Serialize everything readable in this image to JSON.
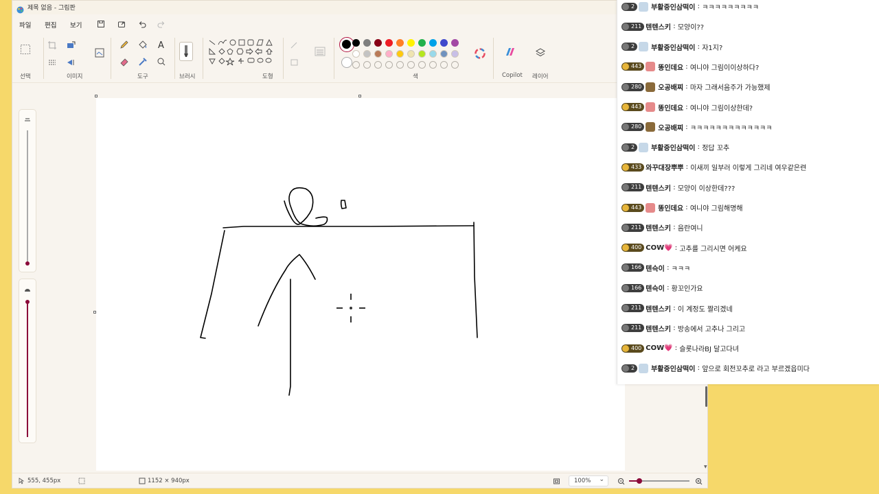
{
  "window": {
    "title": "제목 없음 - 그림판"
  },
  "menu": {
    "file": "파일",
    "edit": "편집",
    "view": "보기"
  },
  "ribbon": {
    "groups": {
      "select": "선택",
      "image": "이미지",
      "tools": "도구",
      "brush": "브러시",
      "shapes": "도형",
      "colors": "색",
      "copilot": "Copilot",
      "layers": "레이어"
    },
    "palette_row1": [
      "#000000",
      "#7f7f7f",
      "#880015",
      "#ed1c24",
      "#ff7f27",
      "#fff200",
      "#22b14c",
      "#00a2e8",
      "#3f48cc",
      "#a349a4"
    ],
    "palette_row2": [
      "#ffffff",
      "#c3c3c3",
      "#b97a57",
      "#ffaec9",
      "#ffc90e",
      "#efe4b0",
      "#b5e61d",
      "#99d9ea",
      "#7092be",
      "#c8bfe7"
    ],
    "primary_color": "#000000",
    "accent_color": "#8b0a3a"
  },
  "status": {
    "cursor_pos": "555, 455px",
    "canvas_size": "1152 × 940px",
    "zoom": "100%"
  },
  "chat": [
    {
      "level": "2",
      "nick": "부활중인삼떡이",
      "msg": "ㅋㅋㅋㅋㅋㅋㅋㅋㅋ",
      "avatar": "#c6d8e8"
    },
    {
      "level": "211",
      "nick": "텐텐스키",
      "msg": "모양이??",
      "avatar": ""
    },
    {
      "level": "2",
      "nick": "부활중인삼떡이",
      "msg": "자1지?",
      "avatar": "#c6d8e8"
    },
    {
      "level": "443",
      "nick": "똥인데요",
      "msg": "여니야 그림이이상하다?",
      "avatar": "#e58a8a",
      "gold": true
    },
    {
      "level": "280",
      "nick": "오공배찌",
      "msg": "마자 그래서음주가 가능했제",
      "avatar": "#8a6a3a"
    },
    {
      "level": "443",
      "nick": "똥인데요",
      "msg": "여니야 그림이상한데?",
      "avatar": "#e58a8a",
      "gold": true
    },
    {
      "level": "280",
      "nick": "오공배찌",
      "msg": "ㅋㅋㅋㅋㅋㅋㅋㅋㅋㅋㅋㅋㅋ",
      "avatar": "#8a6a3a"
    },
    {
      "level": "2",
      "nick": "부활중인삼떡이",
      "msg": "정답 꼬추",
      "avatar": "#c6d8e8"
    },
    {
      "level": "433",
      "nick": "와꾸대장뿌뿌",
      "msg": "이새끼 일부러 이렇게 그리네 여우같은련",
      "avatar": "",
      "gold": true
    },
    {
      "level": "211",
      "nick": "텐텐스키",
      "msg": "모양이 이상한데???",
      "avatar": ""
    },
    {
      "level": "443",
      "nick": "똥인데요",
      "msg": "여니야 그림해명해",
      "avatar": "#e58a8a",
      "gold": true
    },
    {
      "level": "211",
      "nick": "텐텐스키",
      "msg": "음란여니",
      "avatar": ""
    },
    {
      "level": "400",
      "nick": "COW💗",
      "msg": "고추를 그리시면 어케요",
      "avatar": "",
      "gold": true
    },
    {
      "level": "166",
      "nick": "텐슥이",
      "msg": "ㅋㅋㅋ",
      "avatar": ""
    },
    {
      "level": "166",
      "nick": "텐슥이",
      "msg": "황꼬인가요",
      "avatar": ""
    },
    {
      "level": "211",
      "nick": "텐텐스키",
      "msg": "이 계정도 짤리겠네",
      "avatar": ""
    },
    {
      "level": "211",
      "nick": "텐텐스키",
      "msg": "방송에서 고추나 그리고",
      "avatar": ""
    },
    {
      "level": "400",
      "nick": "COW💗",
      "msg": "슬롯나라BJ 달고다녀",
      "avatar": "",
      "gold": true
    },
    {
      "level": "2",
      "nick": "부활중인삼떡이",
      "msg": "앞으로 회전꼬추로 라고 부르겠읍미다",
      "avatar": "#c6d8e8"
    }
  ]
}
